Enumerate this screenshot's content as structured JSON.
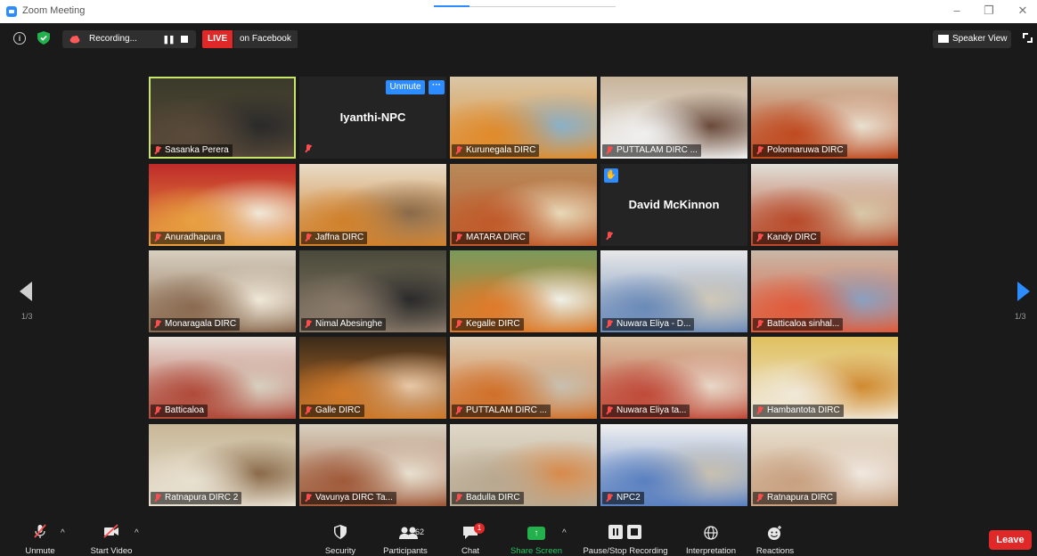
{
  "window": {
    "title": "Zoom Meeting"
  },
  "topbar": {
    "recording_label": "Recording...",
    "live_label": "LIVE",
    "live_target": "on Facebook",
    "speaker_view_label": "Speaker View"
  },
  "nav": {
    "page_left": "1/3",
    "page_right": "1/3"
  },
  "tiles": [
    {
      "name": "Sasanka Perera",
      "colors": [
        "#3a3a2a",
        "#5a4a3a",
        "#2a2a2a"
      ]
    },
    {
      "name": "Iyanthi-NPC",
      "video": false
    },
    {
      "name": "Kurunegala DIRC",
      "colors": [
        "#d9c7a8",
        "#e08a2a",
        "#8ab0c8"
      ]
    },
    {
      "name": "PUTTALAM DIRC ...",
      "colors": [
        "#c8b49a",
        "#f0f0f0",
        "#6a4a3a"
      ]
    },
    {
      "name": "Polonnaruwa DIRC",
      "colors": [
        "#d0c0a8",
        "#c04a20",
        "#e8e0d0"
      ]
    },
    {
      "name": "Anuradhapura",
      "colors": [
        "#c02a2a",
        "#e8a040",
        "#f0e8d8"
      ]
    },
    {
      "name": "Jaffna DIRC",
      "colors": [
        "#e8dcc8",
        "#d0802a",
        "#8a6a4a"
      ]
    },
    {
      "name": "MATARA DIRC",
      "colors": [
        "#b88a5a",
        "#c05a2a",
        "#e8d8b8"
      ]
    },
    {
      "name": "David McKinnon",
      "video": false,
      "hand": true
    },
    {
      "name": "Kandy DIRC",
      "colors": [
        "#e0e0d8",
        "#b84a2a",
        "#d8c8a8"
      ]
    },
    {
      "name": "Monaragala DIRC",
      "colors": [
        "#d8d0c0",
        "#8a6a50",
        "#f0e8d8"
      ]
    },
    {
      "name": "Nimal Abesinghe",
      "colors": [
        "#4a4a3a",
        "#8a7a6a",
        "#2a2a2a"
      ]
    },
    {
      "name": "Kegalle DIRC",
      "colors": [
        "#7a9a5a",
        "#e07a2a",
        "#f0f0e8"
      ]
    },
    {
      "name": "Nuwara Eliya - D...",
      "colors": [
        "#e8e8e8",
        "#6a8ab8",
        "#d0c8b8"
      ]
    },
    {
      "name": "Batticaloa sinhal...",
      "colors": [
        "#c8b8a8",
        "#e05a3a",
        "#8aa0c0"
      ]
    },
    {
      "name": "Batticaloa",
      "colors": [
        "#e8e0d8",
        "#b04a3a",
        "#d8d0c0"
      ]
    },
    {
      "name": "Galle DIRC",
      "colors": [
        "#3a2a1a",
        "#d07a2a",
        "#e8c8a8"
      ]
    },
    {
      "name": "PUTTALAM DIRC ...",
      "colors": [
        "#e0d0b8",
        "#d0702a",
        "#c8c0b0"
      ]
    },
    {
      "name": "Nuwara Eliya ta...",
      "colors": [
        "#d8c0a0",
        "#c04a3a",
        "#e8d8c8"
      ]
    },
    {
      "name": "Hambantota DIRC",
      "colors": [
        "#e0c060",
        "#f0e8d8",
        "#d08a30"
      ]
    },
    {
      "name": "Ratnapura DIRC 2",
      "colors": [
        "#c8b898",
        "#e8e0d0",
        "#8a6a4a"
      ]
    },
    {
      "name": "Vavunya DIRC Ta...",
      "colors": [
        "#d8d0c0",
        "#a05a3a",
        "#e8e0d0"
      ]
    },
    {
      "name": "Badulla DIRC",
      "colors": [
        "#e0d8c8",
        "#b8a890",
        "#d88a4a"
      ]
    },
    {
      "name": "NPC2",
      "colors": [
        "#f0f0f0",
        "#5a80c0",
        "#c8c0b0"
      ]
    },
    {
      "name": "Ratnapura DIRC",
      "colors": [
        "#e8e0d0",
        "#c8a080",
        "#f0e8e0"
      ]
    }
  ],
  "iyanthi_tile": {
    "unmute_label": "Unmute",
    "more_label": "···"
  },
  "toolbar": {
    "unmute": "Unmute",
    "start_video": "Start Video",
    "security": "Security",
    "participants": "Participants",
    "participant_count": "62",
    "chat": "Chat",
    "chat_badge": "1",
    "share_screen": "Share Screen",
    "pause_stop_recording": "Pause/Stop Recording",
    "interpretation": "Interpretation",
    "reactions": "Reactions",
    "leave": "Leave"
  }
}
